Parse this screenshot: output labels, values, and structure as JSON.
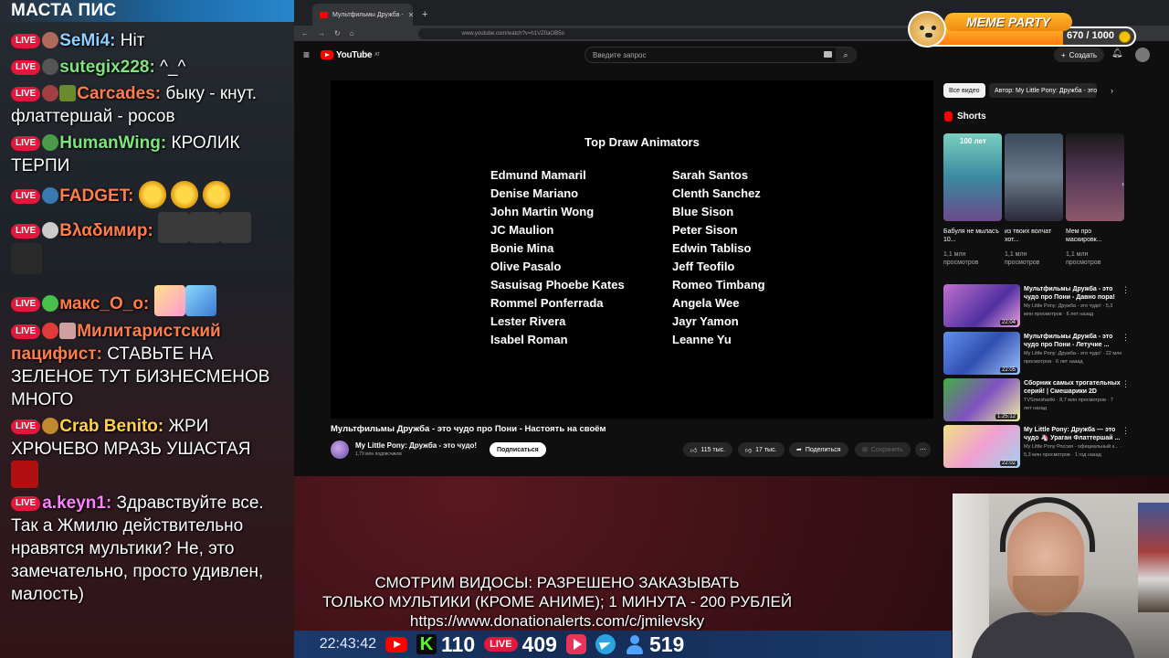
{
  "chat": {
    "channel_label": "МАСТА ПИС",
    "live_badge": "LIVE",
    "messages": [
      {
        "nick": "SeMi4:",
        "nick_color": "#8fd0ff",
        "text": " Ніт"
      },
      {
        "nick": "sutegix228:",
        "nick_color": "#7fe37f",
        "text": " ^_^"
      },
      {
        "nick": "Carcades:",
        "nick_color": "#ff7d4a",
        "text": " быку - кнут. флаттершай - росов"
      },
      {
        "nick": "HumanWing:",
        "nick_color": "#7fe37f",
        "text": " КРОЛИК ТЕРПИ"
      },
      {
        "nick": "FADGET:",
        "nick_color": "#ff7d4a",
        "text": ""
      },
      {
        "nick": "Вλαδимир:",
        "nick_color": "#ff7d4a",
        "text": ""
      },
      {
        "nick": "макс_О_о:",
        "nick_color": "#ff7d4a",
        "text": ""
      },
      {
        "nick": "Милитаристский пацифист:",
        "nick_color": "#ff7d4a",
        "text": " СТАВЬТЕ НА ЗЕЛЕНОЕ ТУТ БИЗНЕСМЕНОВ МНОГО"
      },
      {
        "nick": "Crab Benito:",
        "nick_color": "#ffd24a",
        "text": " ЖРИ ХРЮЧЕВО МРАЗЬ УШАСТАЯ"
      },
      {
        "nick": "a.keyn1:",
        "nick_color": "#ff80ff",
        "text": " Здравствуйте все. Так а Жмилю действительно нравятся мультики? Не, это замечательно, просто удивлен, малость)"
      }
    ]
  },
  "browser": {
    "tab_title": "Мультфильмы Дружба -",
    "url": "www.youtube.com/watch?v=h1VZ0aOB5o"
  },
  "youtube": {
    "logo_text": "YouTube",
    "logo_region": "AT",
    "search_placeholder": "Введите запрос",
    "create_label": "Создать",
    "credits": {
      "title": "Top Draw Animators",
      "left": [
        "Edmund Mamaril",
        "Denise Mariano",
        "John Martin Wong",
        "JC Maulion",
        "Bonie Mina",
        "Olive Pasalo",
        "Sasuisag Phoebe Kates",
        "Rommel Ponferrada",
        "Lester Rivera",
        "Isabel Roman"
      ],
      "right": [
        "Sarah Santos",
        "Clenth Sanchez",
        "Blue Sison",
        "Peter Sison",
        "Edwin Tabliso",
        "Jeff Teofilo",
        "Romeo Timbang",
        "Angela Wee",
        "Jayr Yamon",
        "Leanne Yu"
      ]
    },
    "video_title": "Мультфильмы Дружба - это чудо про Пони - Настоять на своём",
    "channel_name": "My Little Pony: Дружба - это чудо!",
    "channel_subs": "1,79 млн подписчиков",
    "subscribe_label": "Подписаться",
    "likes": "115 тыс.",
    "dislikes": "17 тыс.",
    "share_label": "Поделиться",
    "save_label": "Сохранить",
    "chips": [
      "Все видео",
      "Автор: My Little Pony: Дружба - это"
    ],
    "shorts_label": "Shorts",
    "shorts": [
      {
        "title": "Бабуля не мыласъ 10...",
        "views": "1,1 млн просмотров",
        "overlay": "100 лет"
      },
      {
        "title": "из твоих волчат хот...",
        "views": "1,1 млн просмотров"
      },
      {
        "title": "Мем про маскировк...",
        "views": "1,1 млн просмотров"
      }
    ],
    "recommendations": [
      {
        "title": "Мультфильмы Дружба - это чудо про Пони - Давно пора!",
        "meta": "My Little Pony: Дружба - это чудо! · 5,3 млн просмотров · 6 лет назад",
        "duration": "22:04"
      },
      {
        "title": "Мультфильмы Дружба - это чудо про Пони - Летучие ...",
        "meta": "My Little Pony: Дружба - это чудо! · 22 млн просмотров · 6 лет назад",
        "duration": "22:05"
      },
      {
        "title": "Сборник самых трогательных серий! | Смешарики 2D",
        "meta": "TVSmeshariki · 8,7 млн просмотров · 7 лет назад",
        "duration": "1:25:12"
      },
      {
        "title": "My Little Pony: Дружба — это чудо 🦄 Ураган Флаттершай ...",
        "meta": "My Little Pony Россия - официальный к... · 5,3 млн просмотров · 1 год назад",
        "duration": "22:02"
      }
    ]
  },
  "meme_party": {
    "title": "MEME PARTY",
    "count": "670 / 1000",
    "progress": 0.67
  },
  "overlay": {
    "announce_line1": "СМОТРИМ ВИДОСЫ: РАЗРЕШЕНО ЗАКАЗЫВАТЬ",
    "announce_line2": "ТОЛЬКО МУЛЬТИКИ (КРОМЕ АНИМЕ); 1 МИНУТА - 200 РУБЛЕЙ",
    "announce_link": "https://www.donationalerts.com/c/jmilevsky",
    "clock": "22:43:42",
    "kick_count": "110",
    "live_count": "409",
    "viewers": "519"
  }
}
